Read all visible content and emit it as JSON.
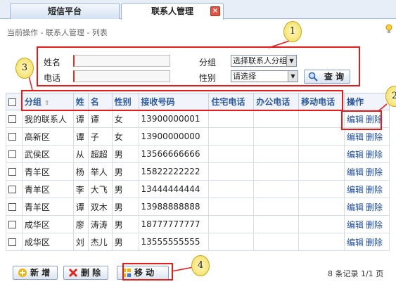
{
  "tabs": [
    {
      "label": "短信平台"
    },
    {
      "label": "联系人管理",
      "close": "×"
    }
  ],
  "breadcrumb": "当前操作 - 联系人管理 - 列表",
  "search": {
    "name_label": "姓名",
    "phone_label": "电话",
    "group_label": "分组",
    "group_value": "选择联系人分组",
    "gender_label": "性别",
    "gender_value": "请选择",
    "query_button": "查 询"
  },
  "table": {
    "columns": [
      "分组",
      "姓",
      "名",
      "性别",
      "接收号码",
      "住宅电话",
      "办公电话",
      "移动电话",
      "操作"
    ],
    "edit_label": "编辑",
    "delete_label": "删除",
    "rows": [
      {
        "group": "我的联系人",
        "surname": "谭",
        "given": "谭",
        "gender": "女",
        "number": "13900000001"
      },
      {
        "group": "高新区",
        "surname": "谭",
        "given": "子",
        "gender": "女",
        "number": "13900000000"
      },
      {
        "group": "武侯区",
        "surname": "从",
        "given": "超超",
        "gender": "男",
        "number": "13566666666"
      },
      {
        "group": "青羊区",
        "surname": "杨",
        "given": "举人",
        "gender": "男",
        "number": "15822222222"
      },
      {
        "group": "青羊区",
        "surname": "李",
        "given": "大飞",
        "gender": "男",
        "number": "13444444444"
      },
      {
        "group": "青羊区",
        "surname": "谭",
        "given": "双木",
        "gender": "男",
        "number": "13988888888"
      },
      {
        "group": "成华区",
        "surname": "廖",
        "given": "涛涛",
        "gender": "男",
        "number": "18777777777"
      },
      {
        "group": "成华区",
        "surname": "刘",
        "given": "杰儿",
        "gender": "男",
        "number": "13555555555"
      }
    ]
  },
  "buttons": {
    "add": "新 增",
    "delete": "删 除",
    "move": "移 动"
  },
  "footer": "8 条记录  1/1 页",
  "callouts": [
    "1",
    "2",
    "3",
    "4"
  ],
  "colors": {
    "annotation": "#e31b1b",
    "header_text": "#2a57a0",
    "link": "#1e4ea8"
  }
}
